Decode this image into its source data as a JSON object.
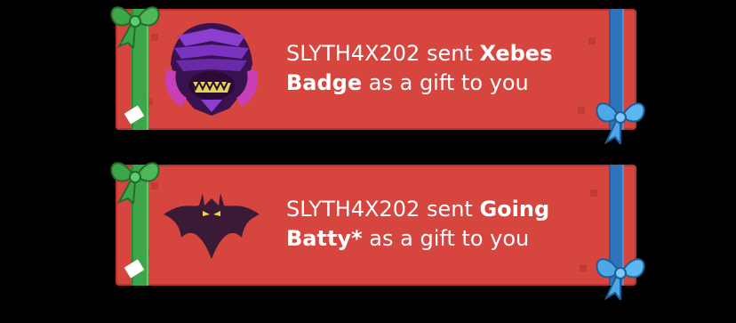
{
  "notifications": [
    {
      "sender": "SLYTH4X202",
      "verb": "sent",
      "item": "Xebes Badge",
      "suffix": "as a gift to you",
      "icon": "xebes-badge-icon",
      "ribbon_color": "#3da648",
      "side_ribbon_color": "#2f73bd"
    },
    {
      "sender": "SLYTH4X202",
      "verb": "sent",
      "item": "Going Batty*",
      "suffix": "as a gift to you",
      "icon": "bat-icon",
      "ribbon_color": "#3da648",
      "side_ribbon_color": "#2f73bd"
    }
  ],
  "colors": {
    "card": "#d6453e",
    "background": "#000000",
    "text": "#ffffff"
  }
}
